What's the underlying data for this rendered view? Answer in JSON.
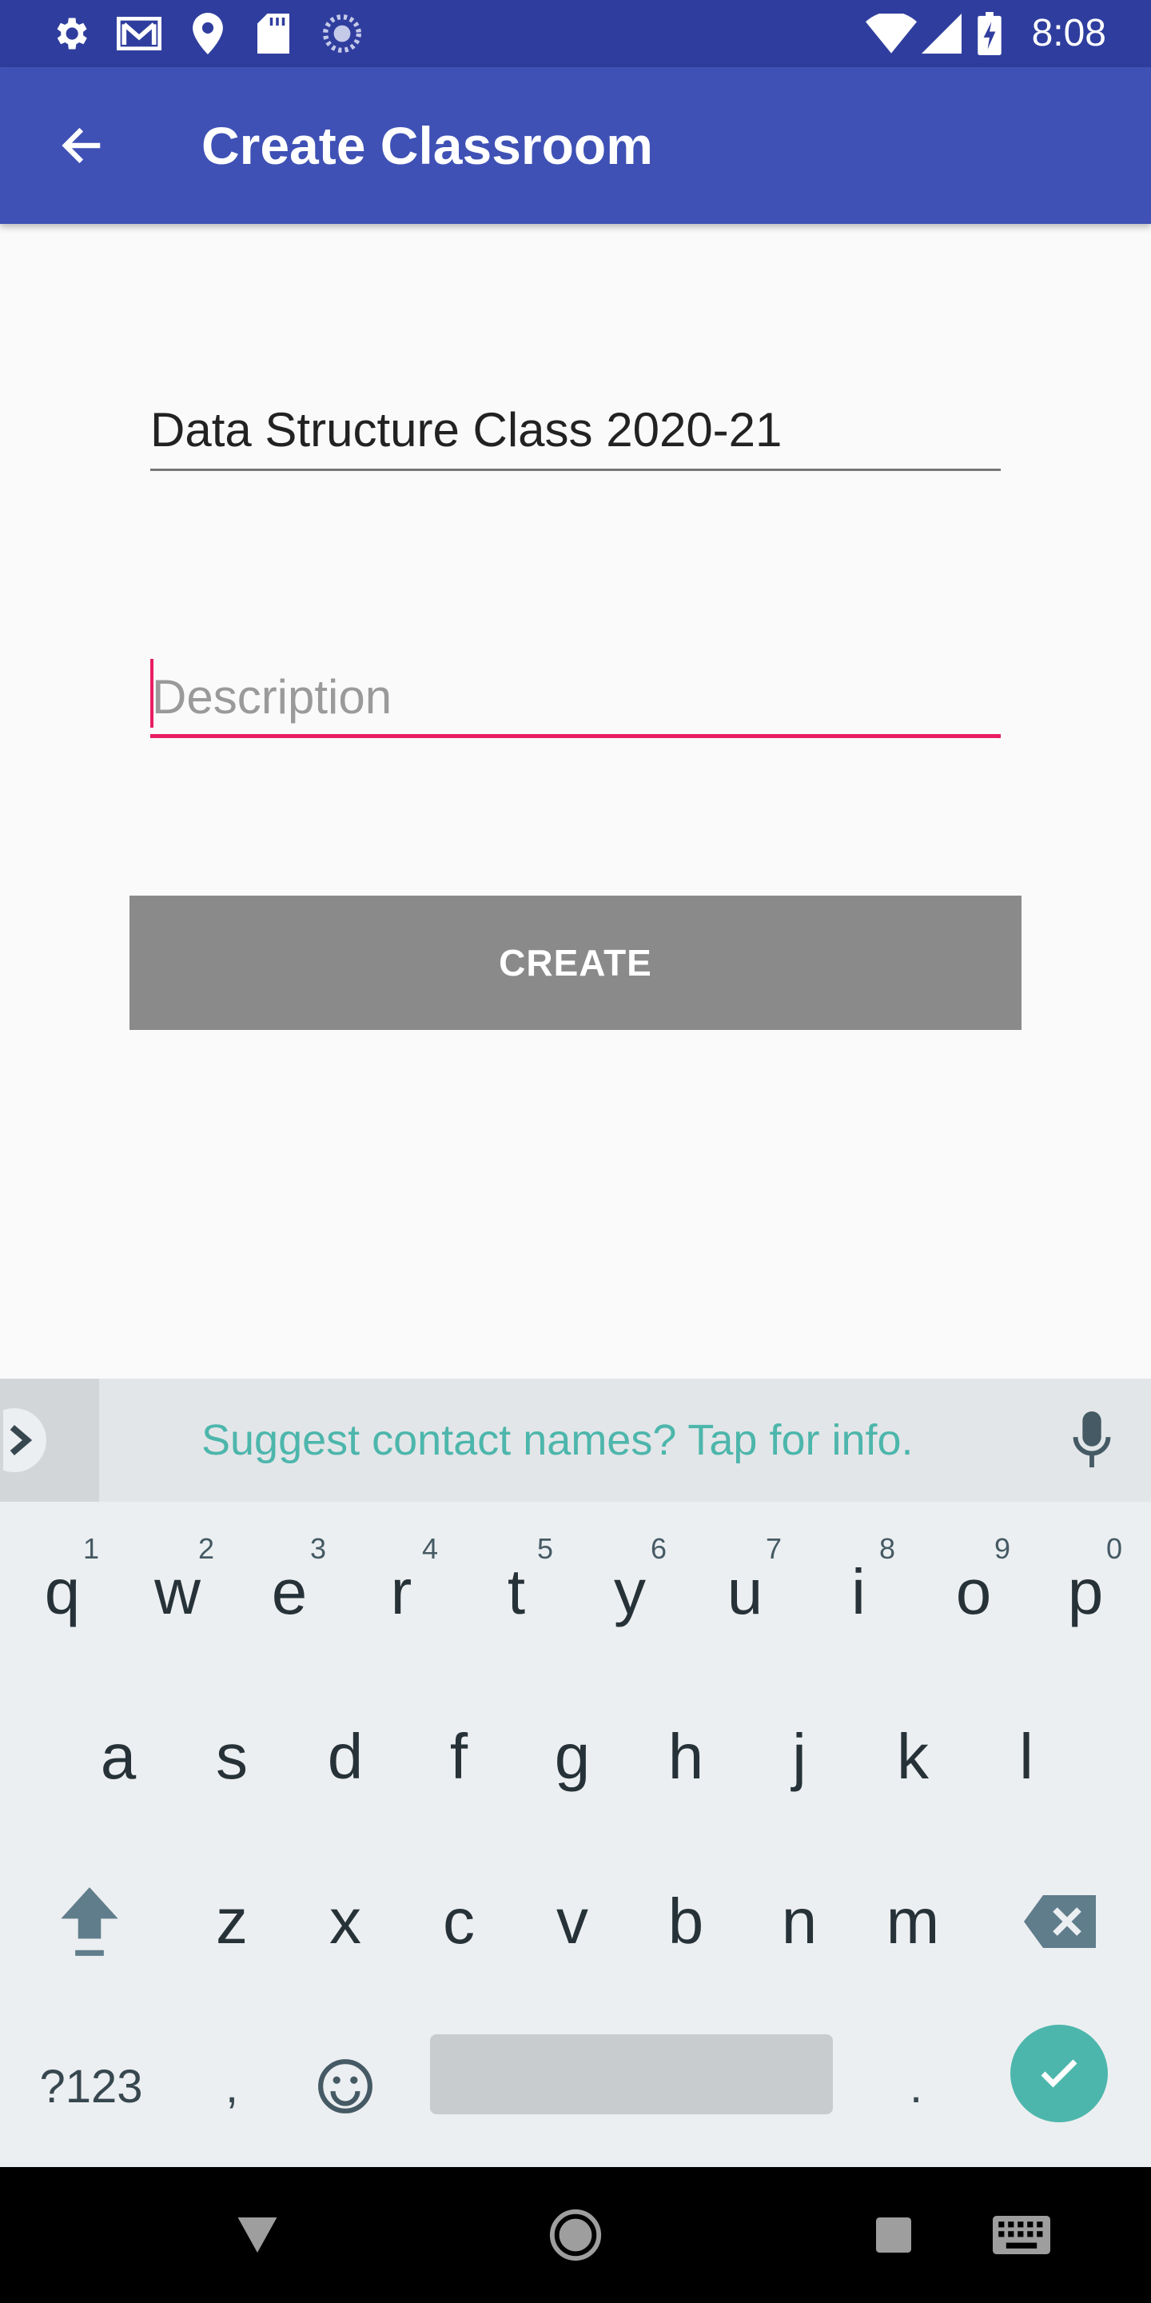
{
  "status_bar": {
    "time": "8:08",
    "left_icons": [
      "settings-icon",
      "gmail-icon",
      "location-icon",
      "sd-card-icon",
      "sync-icon"
    ],
    "right_icons": [
      "wifi-icon",
      "signal-icon",
      "battery-charging-icon"
    ]
  },
  "app_bar": {
    "title": "Create Classroom",
    "background": "#3f51b5",
    "status_color": "#2f3e9e"
  },
  "form": {
    "name_value": "Data Structure Class 2020-21",
    "description_placeholder": "Description",
    "create_label": "CREATE",
    "accent": "#e91e63"
  },
  "keyboard": {
    "suggestion": "Suggest contact names? Tap for info.",
    "row1": [
      "q",
      "w",
      "e",
      "r",
      "t",
      "y",
      "u",
      "i",
      "o",
      "p"
    ],
    "row1_hints": [
      "1",
      "2",
      "3",
      "4",
      "5",
      "6",
      "7",
      "8",
      "9",
      "0"
    ],
    "row2": [
      "a",
      "s",
      "d",
      "f",
      "g",
      "h",
      "j",
      "k",
      "l"
    ],
    "row3": [
      "z",
      "x",
      "c",
      "v",
      "b",
      "n",
      "m"
    ],
    "symbols_label": "?123",
    "comma": ",",
    "period": ".",
    "accent": "#4db6ac"
  },
  "nav_bar": {
    "icons": [
      "back-triangle-icon",
      "home-circle-icon",
      "recents-square-icon",
      "keyboard-icon"
    ]
  }
}
